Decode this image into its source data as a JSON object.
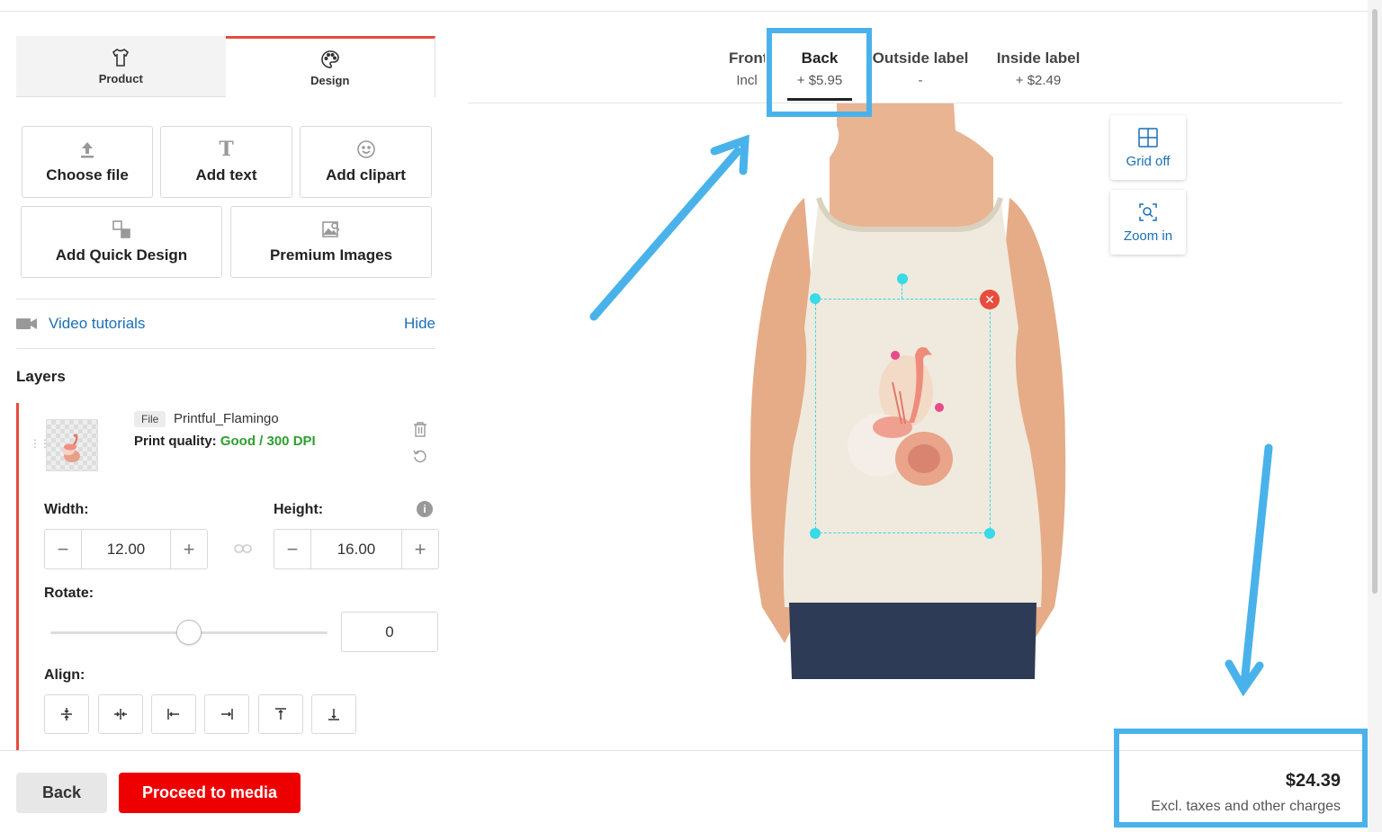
{
  "tabs": {
    "product_label": "Product",
    "design_label": "Design"
  },
  "tools": {
    "choose_file": "Choose file",
    "add_text": "Add text",
    "add_clipart": "Add clipart",
    "add_quick_design": "Add Quick Design",
    "premium_images": "Premium Images"
  },
  "video": {
    "label": "Video tutorials",
    "hide": "Hide"
  },
  "layers": {
    "title": "Layers",
    "file_badge": "File",
    "file_name": "Printful_Flamingo",
    "print_quality_label": "Print quality:",
    "print_quality_value": "Good / 300 DPI",
    "width_label": "Width:",
    "width_value": "12.00",
    "height_label": "Height:",
    "height_value": "16.00",
    "rotate_label": "Rotate:",
    "rotate_value": "0",
    "rotate_slider_fraction": 0.5,
    "align_label": "Align:",
    "align_icons": [
      "align-center-vertical-icon",
      "align-center-horizontal-icon",
      "align-left-icon",
      "align-right-icon",
      "align-top-icon",
      "align-bottom-icon"
    ]
  },
  "placements": [
    {
      "name": "Front",
      "price": "Incl"
    },
    {
      "name": "Back",
      "price": "+ $5.95",
      "active": true
    },
    {
      "name": "Outside label",
      "price": "-"
    },
    {
      "name": "Inside label",
      "price": "+ $2.49"
    }
  ],
  "canvas_tools": {
    "grid_label": "Grid off",
    "zoom_label": "Zoom in"
  },
  "footer": {
    "back_label": "Back",
    "proceed_label": "Proceed to media",
    "price": "$24.39",
    "price_note": "Excl. taxes and other charges"
  },
  "colors": {
    "accent_red": "#e00000",
    "link_blue": "#1a6fb5",
    "annotation_blue": "#4ab2ea",
    "good_green": "#2f9e2f"
  }
}
